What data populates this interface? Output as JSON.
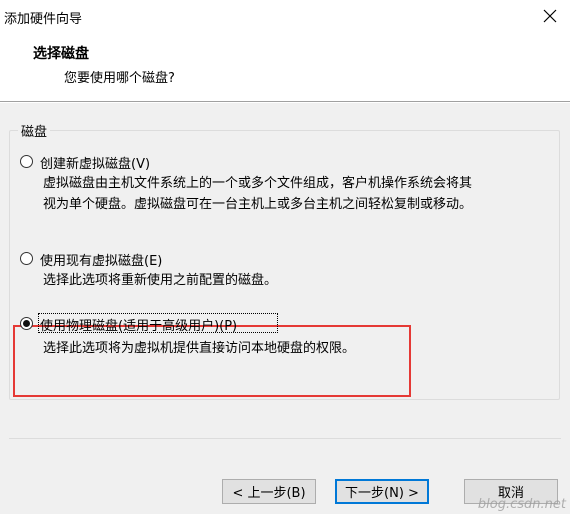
{
  "window": {
    "title": "添加硬件向导"
  },
  "header": {
    "title": "选择磁盘",
    "subtitle": "您要使用哪个磁盘?"
  },
  "group": {
    "label": "磁盘",
    "options": [
      {
        "label": "创建新虚拟磁盘(V)",
        "desc": [
          "虚拟磁盘由主机文件系统上的一个或多个文件组成，客户机操作系统会将其",
          "视为单个硬盘。虚拟磁盘可在一台主机上或多台主机之间轻松复制或移动。"
        ],
        "checked": false
      },
      {
        "label": "使用现有虚拟磁盘(E)",
        "desc": [
          "选择此选项将重新使用之前配置的磁盘。"
        ],
        "checked": false
      },
      {
        "label": "使用物理磁盘(适用于高级用户)(P)",
        "desc": [
          "选择此选项将为虚拟机提供直接访问本地硬盘的权限。"
        ],
        "checked": true
      }
    ]
  },
  "buttons": {
    "back": "< 上一步(B)",
    "next": "下一步(N) >",
    "cancel": "取消"
  },
  "watermark": "blog.csdn.net",
  "colors": {
    "highlight": "#e53935",
    "primary_border": "#0078d7"
  },
  "icons": {
    "close": "close-icon"
  }
}
